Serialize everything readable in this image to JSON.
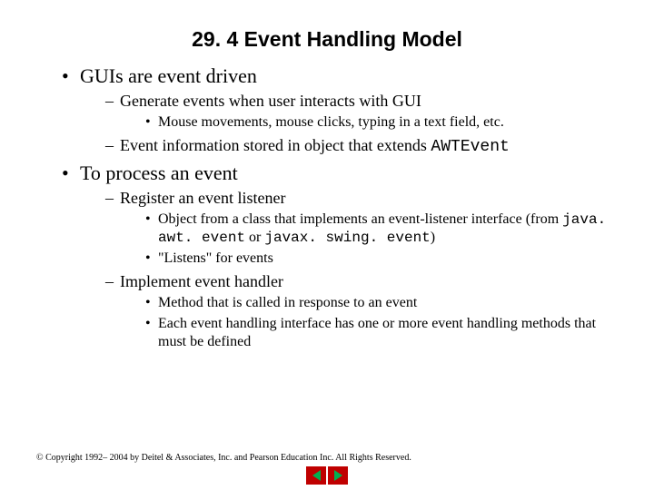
{
  "title": "29. 4  Event Handling Model",
  "bullets": {
    "b1": "GUIs are event driven",
    "b1_1": "Generate events when user interacts with GUI",
    "b1_1_1": "Mouse movements, mouse clicks, typing in a text field, etc.",
    "b1_2_pre": "Event information stored in object that extends ",
    "b1_2_code": "AWTEvent",
    "b2": "To process an event",
    "b2_1": "Register an event listener",
    "b2_1_1_pre": "Object from a class that implements an event-listener interface (from ",
    "b2_1_1_code1": "java. awt. event",
    "b2_1_1_mid": " or ",
    "b2_1_1_code2": "javax. swing. event",
    "b2_1_1_post": ")",
    "b2_1_2": "\"Listens\" for events",
    "b2_2": "Implement event handler",
    "b2_2_1": "Method that is called in response to an event",
    "b2_2_2": "Each event handling interface has one or more event handling methods that must be defined"
  },
  "footer": "© Copyright 1992– 2004 by Deitel & Associates, Inc. and Pearson Education Inc. All Rights Reserved."
}
